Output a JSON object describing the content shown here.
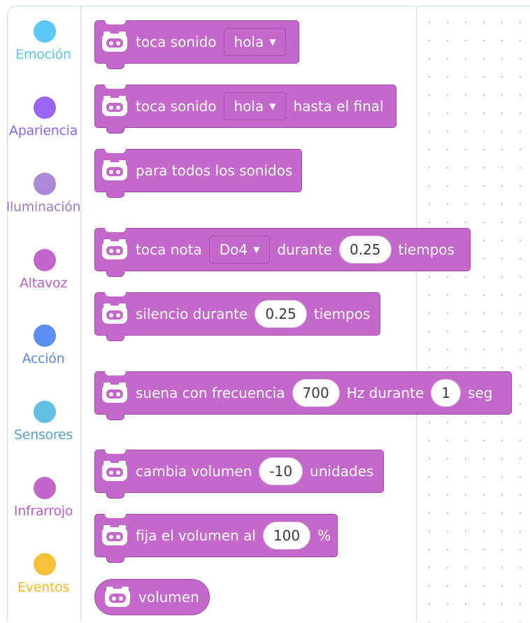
{
  "categories": [
    {
      "label": "Emoción",
      "color": "#5cc8f7",
      "label_color": "#5fc3e7"
    },
    {
      "label": "Apariencia",
      "color": "#9966f2",
      "label_color": "#8d64e8"
    },
    {
      "label": "Iluminación",
      "color": "#ac88d5",
      "label_color": "#9a7dc9"
    },
    {
      "label": "Altavoz",
      "color": "#c466c9",
      "label_color": "#b75fbf"
    },
    {
      "label": "Acción",
      "color": "#5c8ef5",
      "label_color": "#5b8ae8"
    },
    {
      "label": "Sensores",
      "color": "#64c0e2",
      "label_color": "#5aa3c8"
    },
    {
      "label": "Infrarrojo",
      "color": "#c466c9",
      "label_color": "#b75fbf"
    },
    {
      "label": "Eventos",
      "color": "#f7c23a",
      "label_color": "#f5b81f"
    }
  ],
  "blocks": {
    "play_sound": {
      "text": "toca sonido",
      "dropdown": "hola",
      "dropdown_icon": "caret-down-icon"
    },
    "play_sound_until_done": {
      "text": "toca sonido",
      "dropdown": "hola",
      "suffix": "hasta el final",
      "dropdown_icon": "caret-down-icon"
    },
    "stop_all_sounds": {
      "text": "para todos los sonidos"
    },
    "play_note": {
      "text": "toca nota",
      "dropdown": "Do4",
      "mid": "durante",
      "value": "0.25",
      "suffix": "tiempos"
    },
    "rest": {
      "text": "silencio durante",
      "value": "0.25",
      "suffix": "tiempos"
    },
    "play_frequency": {
      "text": "suena con frecuencia",
      "value1": "700",
      "mid": "Hz durante",
      "value2": "1",
      "suffix": "seg"
    },
    "change_volume": {
      "text": "cambia volumen",
      "value": "-10",
      "suffix": "unidades"
    },
    "set_volume": {
      "text": "fija el volumen al",
      "value": "100",
      "suffix": "%"
    },
    "volume_reporter": {
      "text": "volumen"
    }
  },
  "colors": {
    "block": "#c568cb",
    "block_border": "#9d4aa6"
  },
  "arrow_glyph": "▼"
}
